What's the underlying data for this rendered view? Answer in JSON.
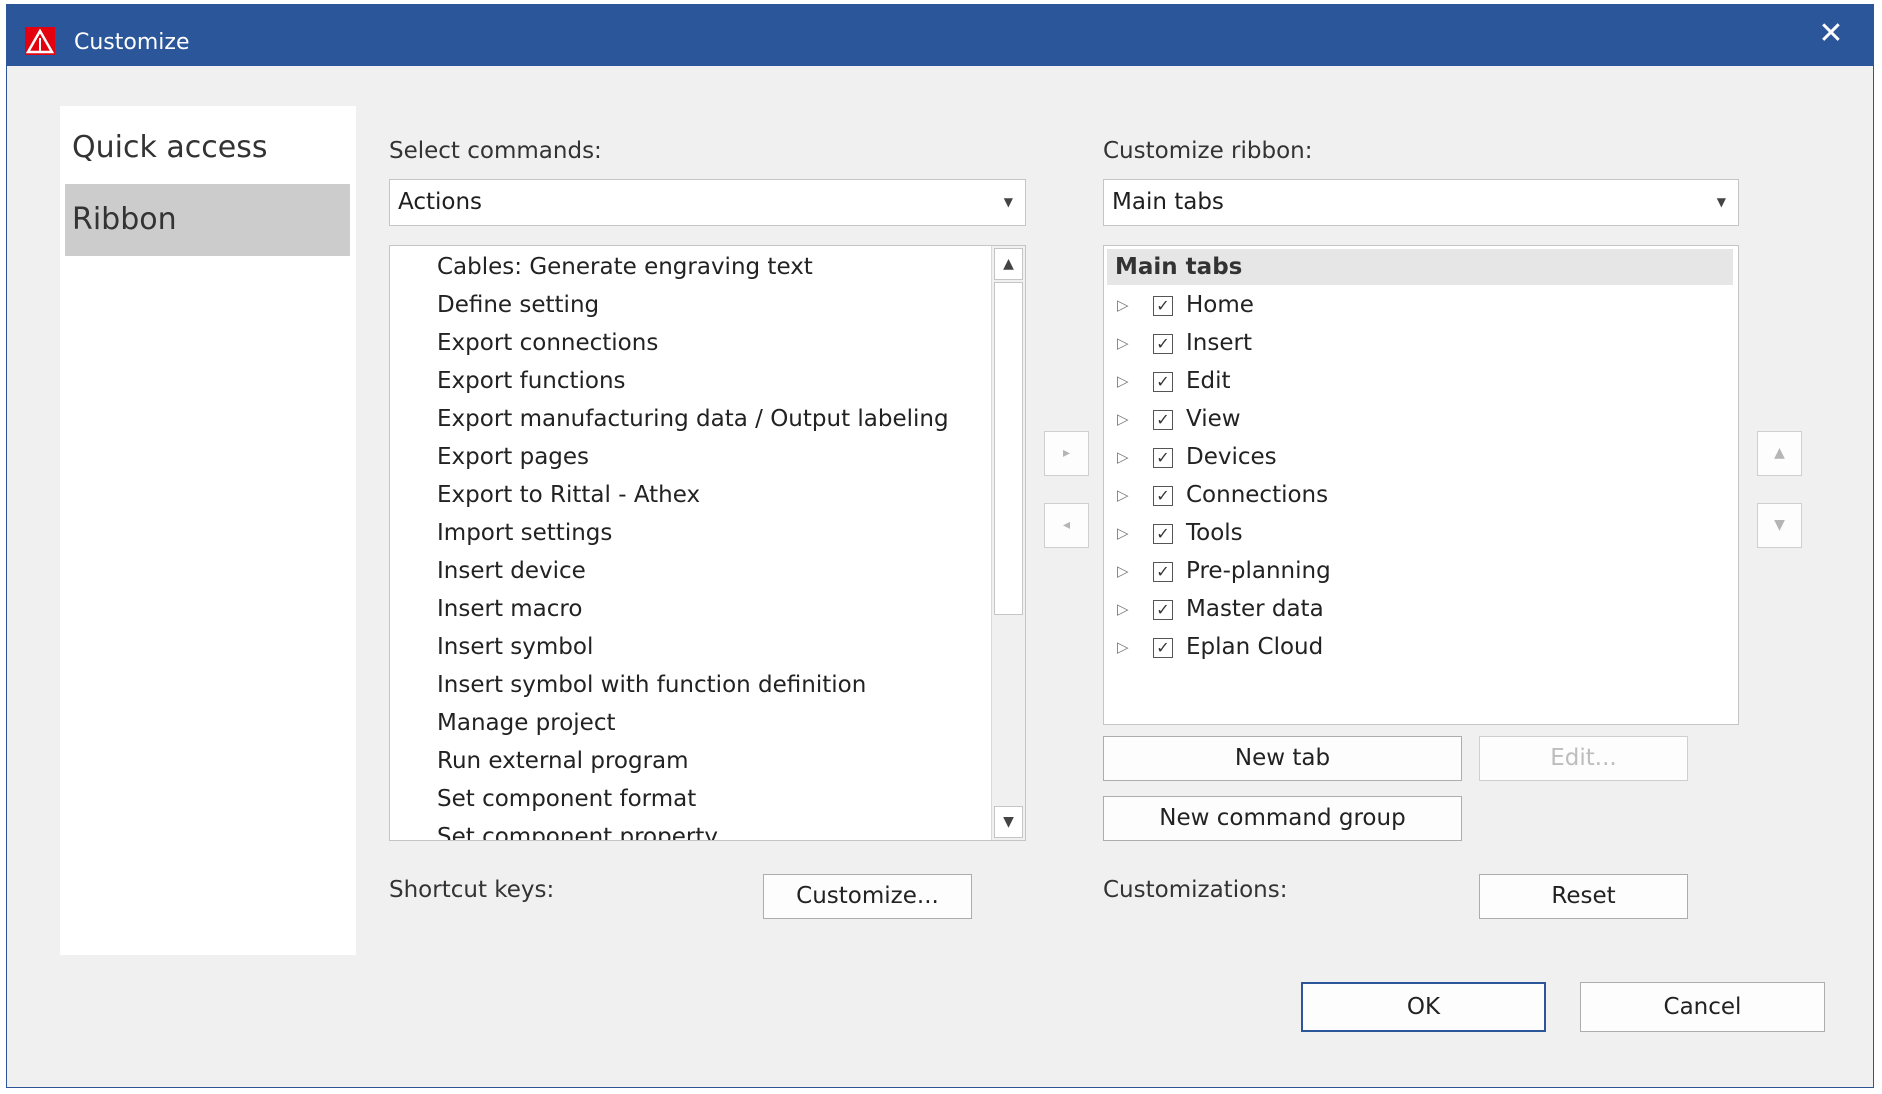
{
  "window": {
    "title": "Customize",
    "close_glyph": "✕"
  },
  "nav": {
    "items": [
      {
        "label": "Quick access",
        "selected": false
      },
      {
        "label": "Ribbon",
        "selected": true
      }
    ]
  },
  "select_commands": {
    "label": "Select commands:",
    "dropdown_value": "Actions",
    "items": [
      "Cables: Generate engraving text",
      "Define setting",
      "Export connections",
      "Export functions",
      "Export manufacturing data / Output labeling",
      "Export pages",
      "Export to Rittal - Athex",
      "Import settings",
      "Insert device",
      "Insert macro",
      "Insert symbol",
      "Insert symbol with function definition",
      "Manage project",
      "Run external program",
      "Set component format",
      "Set component property"
    ]
  },
  "customize_ribbon": {
    "label": "Customize ribbon:",
    "dropdown_value": "Main tabs",
    "tree_header": "Main tabs",
    "tabs": [
      {
        "label": "Home",
        "checked": true
      },
      {
        "label": "Insert",
        "checked": true
      },
      {
        "label": "Edit",
        "checked": true
      },
      {
        "label": "View",
        "checked": true
      },
      {
        "label": "Devices",
        "checked": true
      },
      {
        "label": "Connections",
        "checked": true
      },
      {
        "label": "Tools",
        "checked": true
      },
      {
        "label": "Pre-planning",
        "checked": true
      },
      {
        "label": "Master data",
        "checked": true
      },
      {
        "label": "Eplan Cloud",
        "checked": true
      }
    ]
  },
  "buttons": {
    "new_tab": "New tab",
    "edit": "Edit...",
    "new_command_group": "New command group",
    "customize": "Customize...",
    "reset": "Reset",
    "ok": "OK",
    "cancel": "Cancel"
  },
  "shortcut_keys_label": "Shortcut keys:",
  "customizations_label": "Customizations:",
  "icons": {
    "add": "▸",
    "remove": "◂",
    "move_up": "▲",
    "move_down": "▼",
    "scroll_up": "▲",
    "scroll_down": "▼",
    "expander": "▷",
    "check": "✓",
    "dropdown": "▼"
  },
  "colors": {
    "titlebar": "#2b579a",
    "selection": "#cccccc",
    "app_icon": "#e3000f"
  }
}
